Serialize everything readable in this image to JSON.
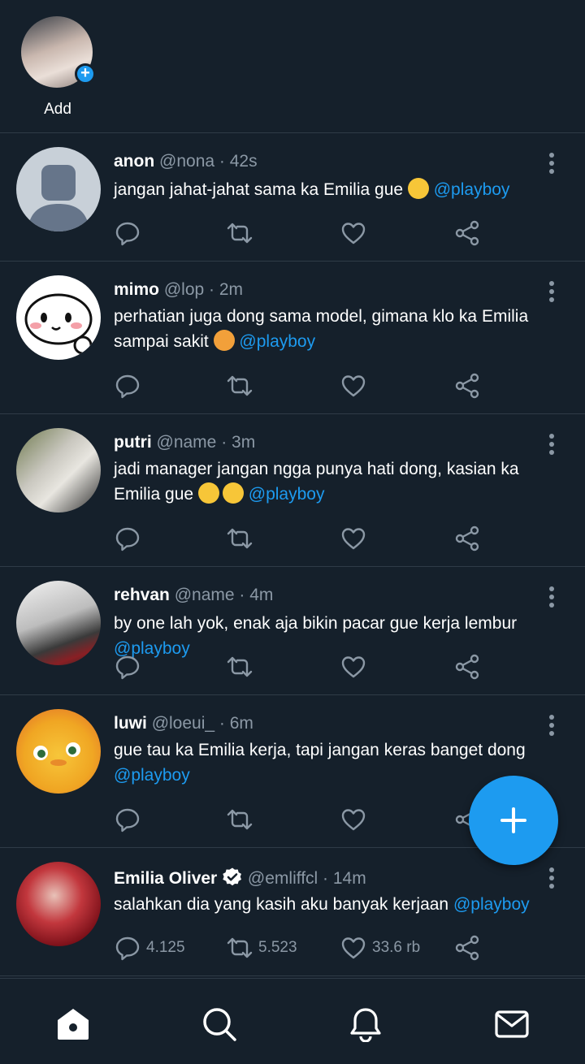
{
  "fleet": {
    "add_label": "Add"
  },
  "tweets": [
    {
      "name": "anon",
      "handle": "@nona",
      "time": "42s",
      "text": "jangan jahat-jahat sama ka Emilia gue",
      "mention": "@playboy"
    },
    {
      "name": "mimo",
      "handle": "@lop",
      "time": "2m",
      "text": "perhatian juga dong sama model, gimana klo ka Emilia sampai sakit",
      "mention": "@playboy"
    },
    {
      "name": "putri",
      "handle": "@name",
      "time": "3m",
      "text": "jadi manager jangan ngga punya hati dong, kasian ka Emilia gue",
      "mention": "@playboy"
    },
    {
      "name": "rehvan",
      "handle": "@name",
      "time": "4m",
      "text": "by one lah yok, enak aja bikin pacar gue kerja lembur",
      "mention": "@playboy"
    },
    {
      "name": "luwi",
      "handle": "@loeui_",
      "time": "6m",
      "text": "gue tau ka Emilia kerja, tapi jangan keras banget dong",
      "mention": "@playboy"
    },
    {
      "name": "Emilia Oliver",
      "handle": "@emliffcl",
      "time": "14m",
      "text": "salahkan dia yang kasih aku banyak kerjaan",
      "mention": "@playboy",
      "replies": "4.125",
      "retweets": "5.523",
      "likes": "33.6 rb"
    }
  ],
  "icons": {
    "fab": "compose-plus-icon",
    "nav": [
      "home-icon",
      "search-icon",
      "bell-icon",
      "mail-icon"
    ]
  },
  "colors": {
    "background": "#15202b",
    "accent": "#1d9bf0",
    "muted": "#8b98a5",
    "divider": "#2f3b47"
  }
}
